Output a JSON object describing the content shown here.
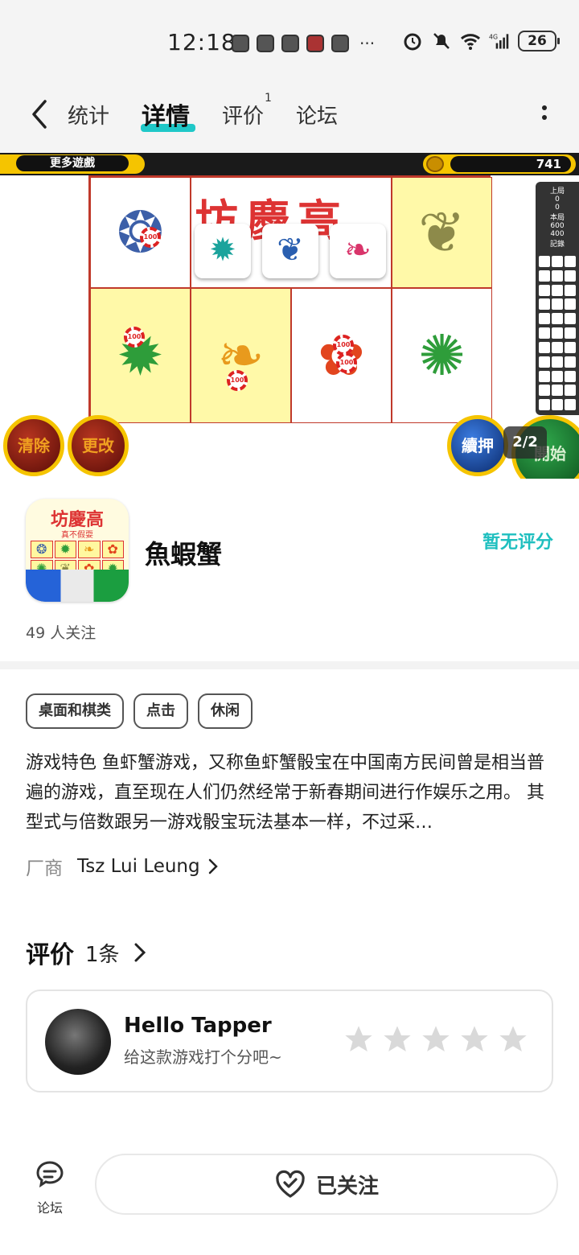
{
  "status_bar": {
    "time": "12:18",
    "more": "···",
    "battery": "26"
  },
  "tabs": {
    "items": [
      {
        "label": "统计"
      },
      {
        "label": "详情"
      },
      {
        "label": "评价"
      },
      {
        "label": "论坛"
      }
    ],
    "active": "详情",
    "review_badge": "1"
  },
  "banner": {
    "more_games": "更多遊戲",
    "coins": "741",
    "board_title": "坊慶高",
    "side_labels": [
      "上局",
      "0",
      "0",
      "本局",
      "600",
      "400",
      "記錄"
    ],
    "buttons": {
      "clear": "清除",
      "change": "更改",
      "rebet": "續押",
      "start": "開始"
    },
    "page_indicator": "2/2"
  },
  "app": {
    "name": "魚蝦蟹",
    "rating": "暂无评分",
    "followers": "49 人关注",
    "icon": {
      "title": "坊慶高",
      "subtitle": "真不假耍"
    }
  },
  "tags": [
    "桌面和棋类",
    "点击",
    "休闲"
  ],
  "description": "游戏特色 鱼虾蟹游戏，又称鱼虾蟹骰宝在中国南方民间曾是相当普遍的游戏，直至现在人们仍然经常于新春期间进行作娱乐之用。 其型式与倍数跟另一游戏骰宝玩法基本一样，不过采…",
  "vendor": {
    "label": "厂商",
    "name": "Tsz Lui Leung"
  },
  "reviews": {
    "title": "评价",
    "count": "1条"
  },
  "rate_card": {
    "user": "Hello Tapper",
    "hint": "给这款游戏打个分吧~",
    "stars": 0
  },
  "bottom": {
    "forum_label": "论坛",
    "follow_label": "已关注"
  },
  "colors": {
    "accent": "#1fc8c8",
    "rating_text": "#1fbfbf",
    "star_empty": "#d9d9d9"
  }
}
